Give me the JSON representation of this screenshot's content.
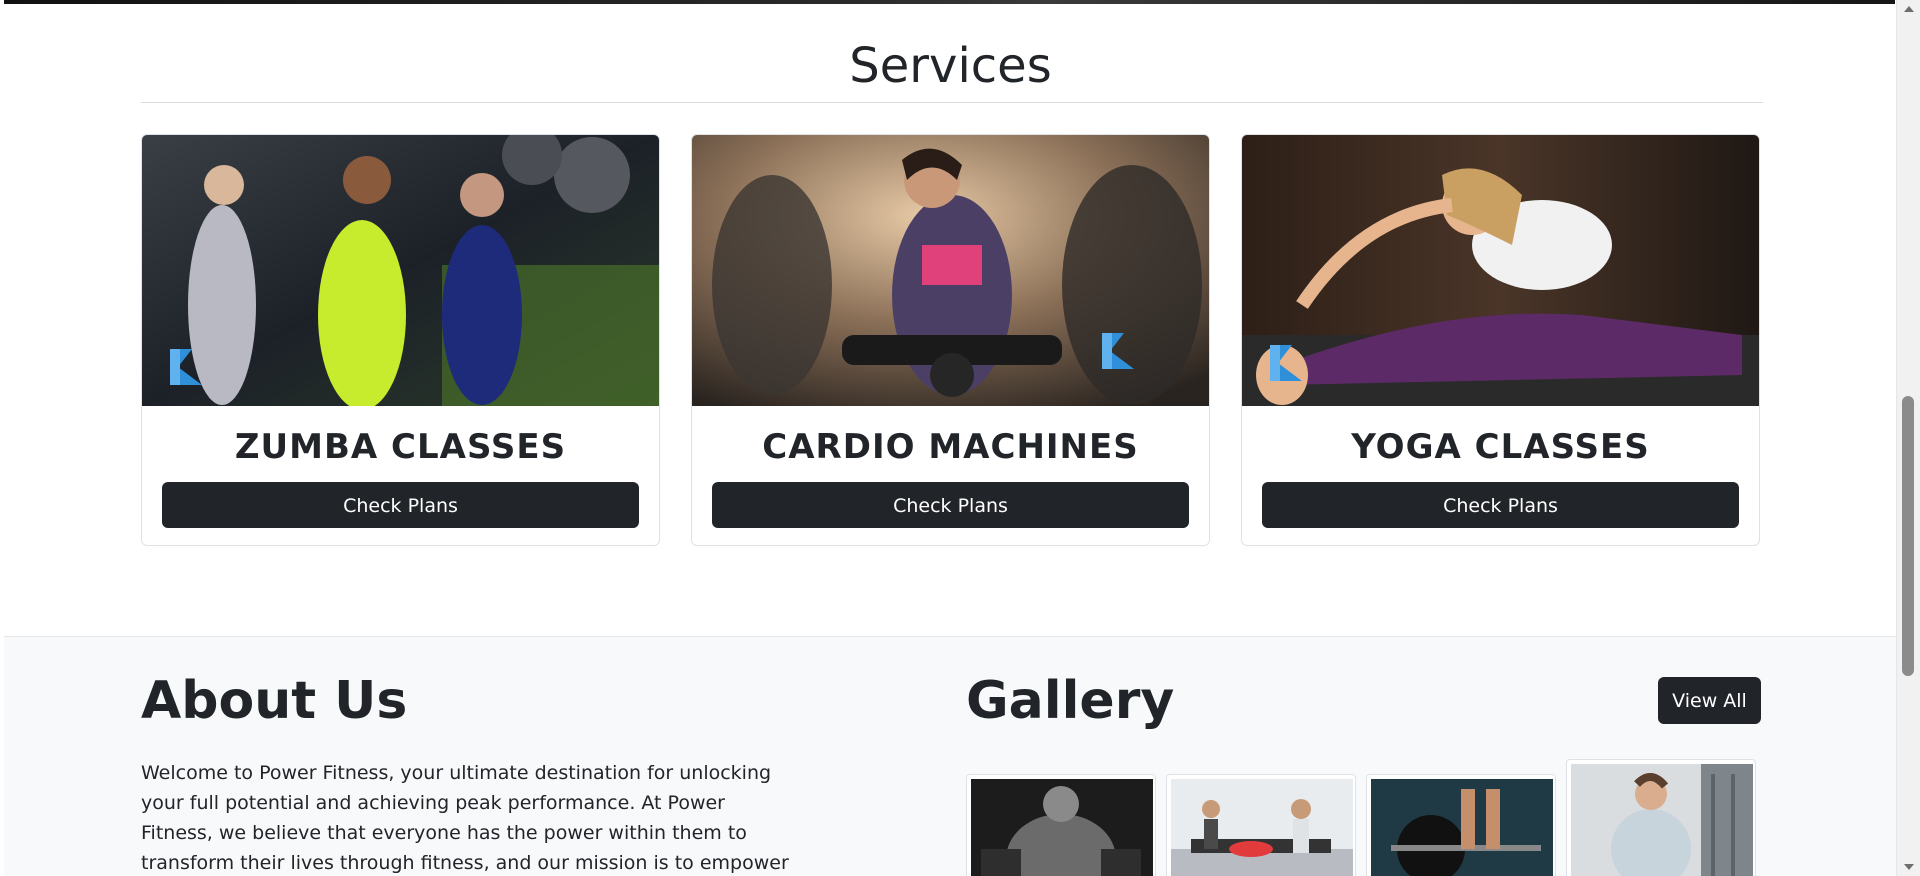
{
  "services": {
    "title": "Services",
    "cards": [
      {
        "title": "ZUMBA CLASSES",
        "button": "Check Plans",
        "image_icon": "zumba-photo"
      },
      {
        "title": "CARDIO MACHINES",
        "button": "Check Plans",
        "image_icon": "cardio-photo"
      },
      {
        "title": "YOGA CLASSES",
        "button": "Check Plans",
        "image_icon": "yoga-photo"
      }
    ]
  },
  "about": {
    "title": "About Us",
    "text": "Welcome to Power Fitness, your ultimate destination for unlocking your full potential and achieving peak performance. At Power Fitness, we believe that everyone has the power within them to transform their lives through fitness, and our mission is to empower you on your journey to"
  },
  "gallery": {
    "title": "Gallery",
    "view_all": "View All",
    "thumbs": [
      "bodybuilder-photo",
      "gym-floor-photo",
      "deadlift-photo",
      "meditation-photo"
    ]
  },
  "colors": {
    "button_dark": "#212529",
    "section_alt_bg": "#f8f9fa",
    "logo_blue": "#2f8fd8"
  }
}
